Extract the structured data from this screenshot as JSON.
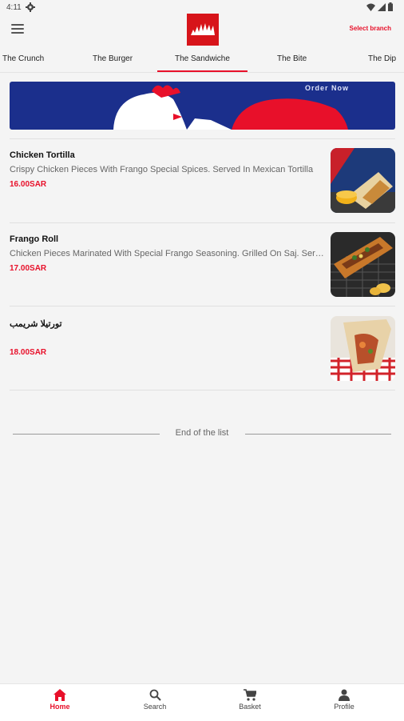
{
  "status_bar": {
    "time": "4:11"
  },
  "header": {
    "select_branch": "Select branch"
  },
  "tabs": [
    {
      "label": "The Crunch"
    },
    {
      "label": "The Burger"
    },
    {
      "label": "The Sandwiche",
      "active": true
    },
    {
      "label": "The Bite"
    },
    {
      "label": "The Dip"
    }
  ],
  "banner": {
    "cta": "Order Now"
  },
  "items": [
    {
      "name": "Chicken Tortilla",
      "description": "Crispy Chicken Pieces With Frango Special Spices. Served In Mexican Tortilla",
      "price": "16.00SAR"
    },
    {
      "name": "Frango Roll",
      "description": "Chicken Pieces Marinated With Special Frango Seasoning. Grilled On Saj. Served",
      "price": "17.00SAR"
    },
    {
      "name": "تورتيلا شريمب",
      "description": "",
      "price": "18.00SAR"
    }
  ],
  "end_of_list": "End of the list",
  "bottom_nav": [
    {
      "label": "Home",
      "icon": "home-icon",
      "active": true
    },
    {
      "label": "Search",
      "icon": "search-icon"
    },
    {
      "label": "Basket",
      "icon": "cart-icon"
    },
    {
      "label": "Profile",
      "icon": "person-icon"
    }
  ],
  "colors": {
    "accent": "#e8102a",
    "banner_blue": "#1b2f8c",
    "logo_red": "#d7141a"
  }
}
